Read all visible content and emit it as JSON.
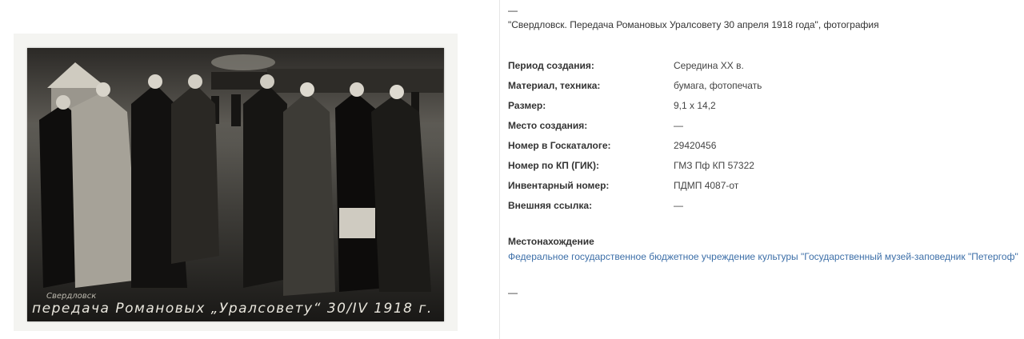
{
  "photo": {
    "caption_small": "Свердловск",
    "caption": "передача Романовых „Уралсовету“ 30/IV 1918 г."
  },
  "info": {
    "top_dash": "—",
    "title": "\"Свердловск. Передача Романовых Уралсовету 30 апреля 1918 года\", фотография",
    "properties": [
      {
        "label": "Период создания:",
        "value": "Середина XX в."
      },
      {
        "label": "Материал, техника:",
        "value": "бумага, фотопечать"
      },
      {
        "label": "Размер:",
        "value": "9,1 х 14,2"
      },
      {
        "label": "Место создания:",
        "value": "—"
      },
      {
        "label": "Номер в Госкаталоге:",
        "value": "29420456"
      },
      {
        "label": "Номер по КП (ГИК):",
        "value": "ГМЗ Пф КП 57322"
      },
      {
        "label": "Инвентарный номер:",
        "value": "ПДМП 4087-от"
      },
      {
        "label": "Внешняя ссылка:",
        "value": "—"
      }
    ],
    "location_label": "Местонахождение",
    "location_link": "Федеральное государственное бюджетное учреждение культуры \"Государственный музей-заповедник \"Петергоф\"",
    "bottom_dash": "—"
  }
}
